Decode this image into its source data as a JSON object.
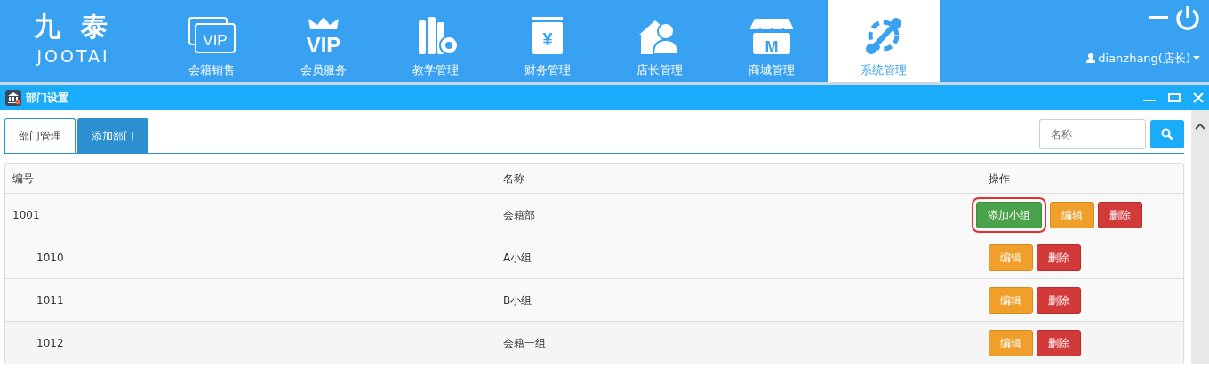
{
  "logo": {
    "mark": "九 泰",
    "wordmark": "JOOTAI"
  },
  "nav": [
    {
      "label": "会籍销售",
      "icon_text": "VIP",
      "selected": false
    },
    {
      "label": "会员服务",
      "icon_text": "VIP",
      "selected": false
    },
    {
      "label": "教学管理",
      "selected": false
    },
    {
      "label": "财务管理",
      "icon_text": "¥",
      "selected": false
    },
    {
      "label": "店长管理",
      "selected": false
    },
    {
      "label": "商城管理",
      "icon_text": "M",
      "selected": false
    },
    {
      "label": "系统管理",
      "selected": true
    }
  ],
  "user": {
    "name": "dianzhang(店长)"
  },
  "window": {
    "title": "部门设置"
  },
  "tabs": [
    {
      "label": "部门管理",
      "selected": true
    },
    {
      "label": "添加部门",
      "selected": false
    }
  ],
  "search": {
    "placeholder": "名称"
  },
  "table": {
    "columns": [
      "编号",
      "名称",
      "操作"
    ],
    "rows": [
      {
        "code": "1001",
        "name": "会籍部",
        "actions": [
          {
            "kind": "add",
            "label": "添加小组",
            "highlighted": true
          },
          {
            "kind": "edit",
            "label": "编辑",
            "highlighted": false
          },
          {
            "kind": "delete",
            "label": "删除",
            "highlighted": false
          }
        ],
        "children": [
          {
            "code": "1010",
            "name": "A小组",
            "actions": [
              {
                "kind": "edit",
                "label": "编辑",
                "highlighted": false
              },
              {
                "kind": "delete",
                "label": "删除",
                "highlighted": false
              }
            ]
          },
          {
            "code": "1011",
            "name": "B小组",
            "actions": [
              {
                "kind": "edit",
                "label": "编辑",
                "highlighted": false
              },
              {
                "kind": "delete",
                "label": "删除",
                "highlighted": false
              }
            ]
          },
          {
            "code": "1012",
            "name": "会籍一组",
            "actions": [
              {
                "kind": "edit",
                "label": "编辑",
                "highlighted": false
              },
              {
                "kind": "delete",
                "label": "删除",
                "highlighted": false
              }
            ]
          }
        ]
      }
    ]
  }
}
